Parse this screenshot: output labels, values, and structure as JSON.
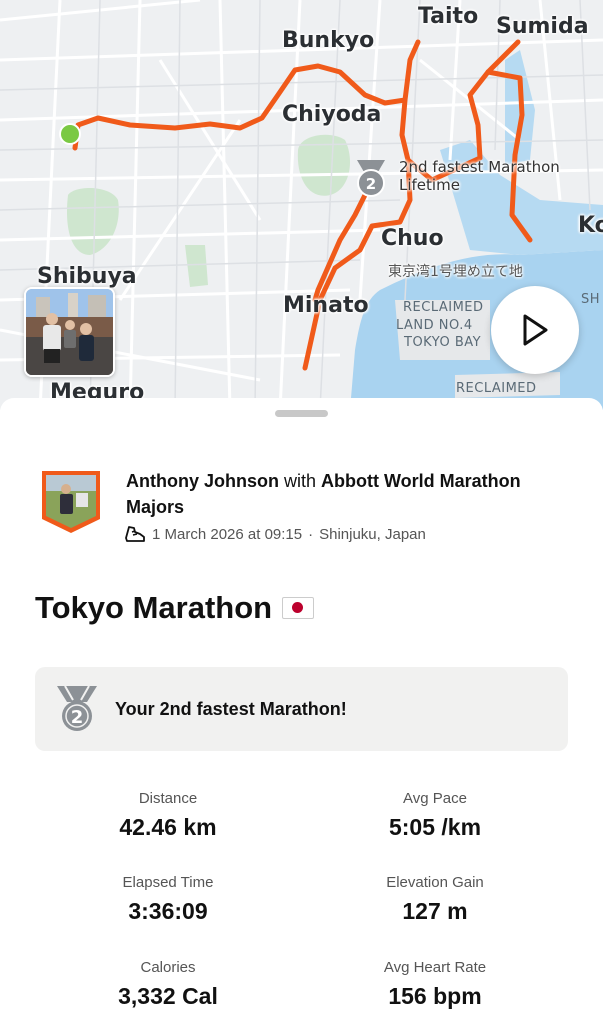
{
  "map": {
    "labels": {
      "taito": "Taito",
      "sumida": "Sumida",
      "bunkyo": "Bunkyo",
      "chiyoda": "Chiyoda",
      "chuo": "Chuo",
      "ko": "Ko",
      "shibuya": "Shibuya",
      "minato": "Minato",
      "meguro": "Meguro",
      "sh": "SH",
      "reclaimed1": "RECLAIMED",
      "land4": "LAND NO.4",
      "tokyobay": "TOKYO BAY",
      "reclaimed2": "RECLAIMED",
      "japanese_label": "東京湾1号埋め立て地"
    },
    "achievement_label_line1": "2nd fastest Marathon",
    "achievement_label_line2": "Lifetime",
    "achievement_rank": "2",
    "route_color": "#f05a1a",
    "start_color": "#7ac943",
    "water_color": "#a9d3f0",
    "park_color": "#cfe6cf"
  },
  "athlete": {
    "name": "Anthony Johnson",
    "with_text": "with",
    "club": "Abbott World Marathon Majors",
    "date_time": "1 March 2026 at 09:15",
    "separator": "·",
    "location": "Shinjuku, Japan"
  },
  "activity": {
    "title": "Tokyo Marathon",
    "achievement_text": "Your 2nd fastest Marathon!",
    "achievement_rank": "2"
  },
  "stats": [
    {
      "label": "Distance",
      "value": "42.46 km"
    },
    {
      "label": "Avg Pace",
      "value": "5:05 /km"
    },
    {
      "label": "Elapsed Time",
      "value": "3:36:09"
    },
    {
      "label": "Elevation Gain",
      "value": "127 m"
    },
    {
      "label": "Calories",
      "value": "3,332 Cal"
    },
    {
      "label": "Avg Heart Rate",
      "value": "156 bpm"
    }
  ],
  "colors": {
    "accent": "#f05a1a",
    "text_primary": "#111111",
    "text_secondary": "#555555",
    "card_bg": "#f1f1f0",
    "medal_gray": "#8c9196"
  }
}
